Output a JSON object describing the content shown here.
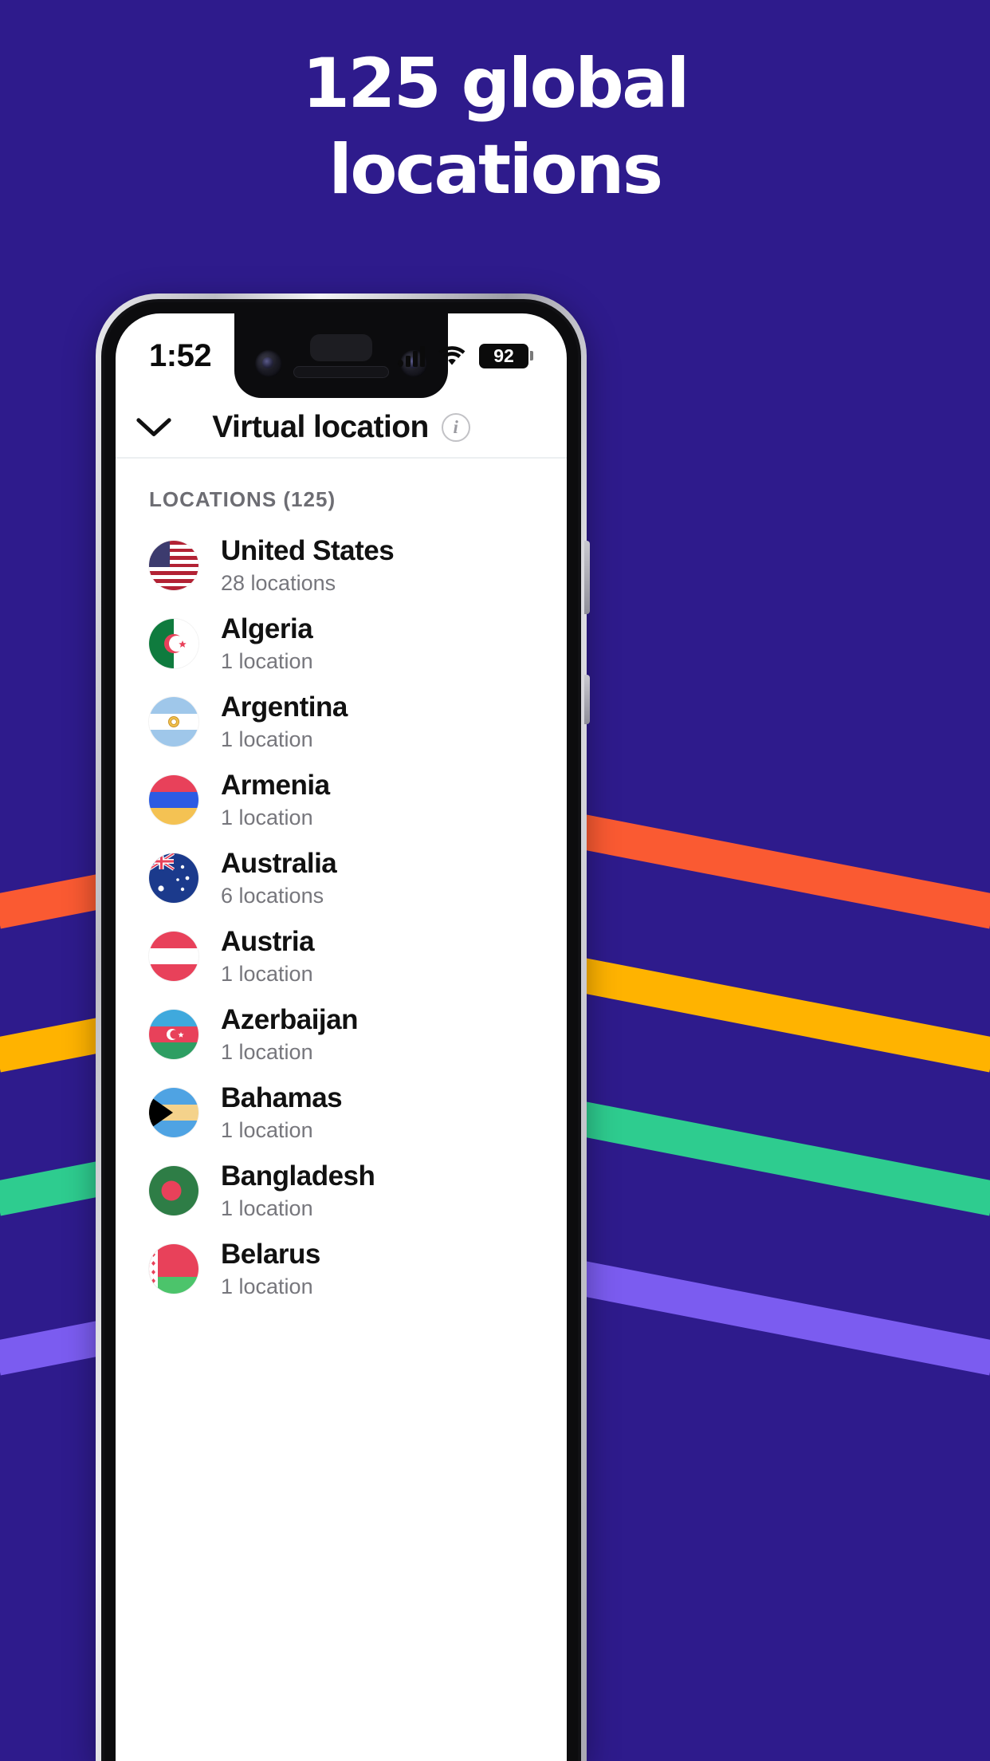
{
  "promo": {
    "headline_line1": "125 global",
    "headline_line2": "locations",
    "bg_color": "#2E1B8C",
    "stripe_colors": [
      "#FA5A32",
      "#FFB300",
      "#2ECC8F",
      "#7B5CF0"
    ]
  },
  "status_bar": {
    "time": "1:52",
    "battery_percent": "92",
    "signal_icon": "signal-bars-icon",
    "wifi_icon": "wifi-icon",
    "battery_icon": "battery-icon"
  },
  "nav": {
    "back_icon": "chevron-down-icon",
    "title": "Virtual location",
    "info_icon": "info-icon",
    "info_label": "i"
  },
  "list": {
    "section_header": "LOCATIONS (125)",
    "items": [
      {
        "country": "United States",
        "sub": "28 locations",
        "flag": "flag-us"
      },
      {
        "country": "Algeria",
        "sub": "1 location",
        "flag": "flag-dz"
      },
      {
        "country": "Argentina",
        "sub": "1 location",
        "flag": "flag-ar"
      },
      {
        "country": "Armenia",
        "sub": "1 location",
        "flag": "flag-am"
      },
      {
        "country": "Australia",
        "sub": "6 locations",
        "flag": "flag-au"
      },
      {
        "country": "Austria",
        "sub": "1 location",
        "flag": "flag-at"
      },
      {
        "country": "Azerbaijan",
        "sub": "1 location",
        "flag": "flag-az"
      },
      {
        "country": "Bahamas",
        "sub": "1 location",
        "flag": "flag-bs"
      },
      {
        "country": "Bangladesh",
        "sub": "1 location",
        "flag": "flag-bd"
      },
      {
        "country": "Belarus",
        "sub": "1 location",
        "flag": "flag-by"
      }
    ]
  }
}
